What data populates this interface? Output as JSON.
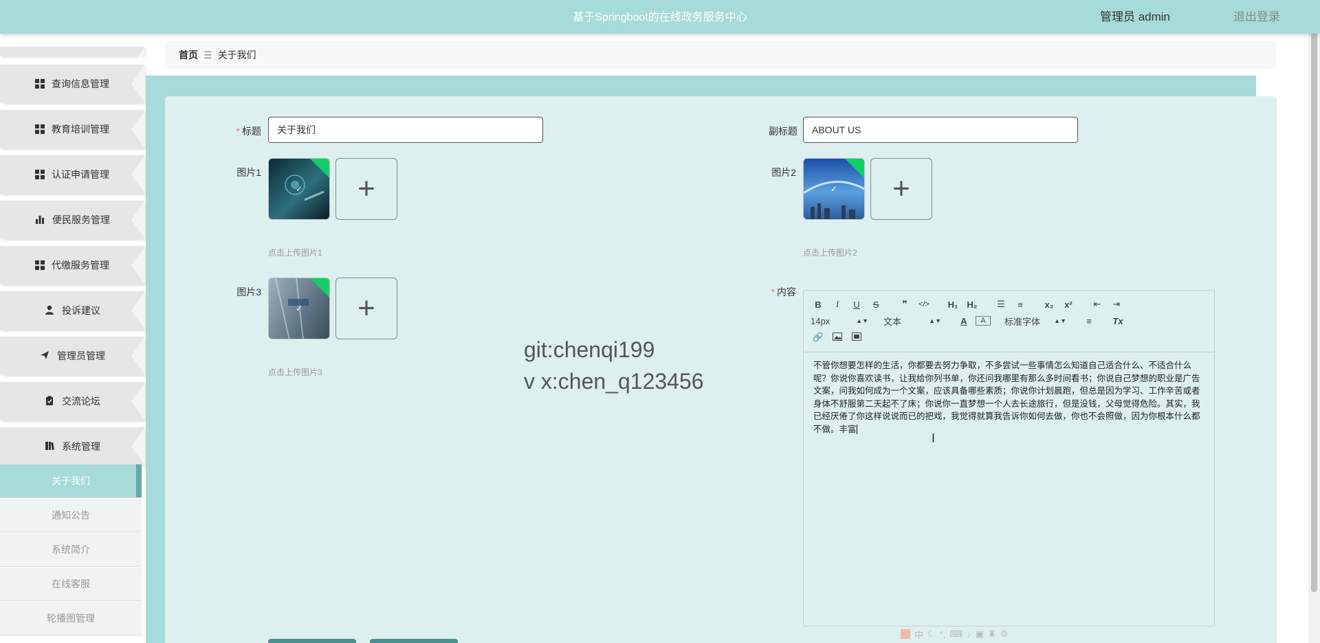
{
  "header": {
    "title": "基于Springboot的在线政务服务中心",
    "user": "管理员 admin",
    "logout": "退出登录"
  },
  "sidebar": {
    "items": [
      {
        "label": "查询信息管理",
        "icon": "grid-icon"
      },
      {
        "label": "教育培训管理",
        "icon": "grid-icon"
      },
      {
        "label": "认证申请管理",
        "icon": "grid-icon"
      },
      {
        "label": "便民服务管理",
        "icon": "bar-chart-icon"
      },
      {
        "label": "代缴服务管理",
        "icon": "grid-icon"
      },
      {
        "label": "投诉建议",
        "icon": "user-icon"
      },
      {
        "label": "管理员管理",
        "icon": "send-icon"
      },
      {
        "label": "交流论坛",
        "icon": "clipboard-icon"
      },
      {
        "label": "系统管理",
        "icon": "book-icon"
      }
    ],
    "subitems": [
      {
        "label": "关于我们",
        "active": true
      },
      {
        "label": "通知公告",
        "active": false
      },
      {
        "label": "系统简介",
        "active": false
      },
      {
        "label": "在线客服",
        "active": false
      },
      {
        "label": "轮播图管理",
        "active": false
      }
    ]
  },
  "breadcrumb": {
    "home": "首页",
    "separator": "☰",
    "current": "关于我们"
  },
  "form": {
    "title_label": "标题",
    "title_value": "关于我们",
    "subtitle_label": "副标题",
    "subtitle_value": "ABOUT US",
    "pic1_label": "图片1",
    "pic1_hint": "点击上传图片1",
    "pic2_label": "图片2",
    "pic2_hint": "点击上传图片2",
    "pic3_label": "图片3",
    "pic3_hint": "点击上传图片3",
    "content_label": "内容",
    "plus": "+"
  },
  "watermark": {
    "line1": "git:chenqi199",
    "line2": "v x:chen_q123456"
  },
  "editor": {
    "font_size": "14px",
    "block_type": "文本",
    "font_family": "标准字体",
    "h1": "H₁",
    "h2": "H₂",
    "sub": "x₂",
    "sup": "x²",
    "content": "不管你想要怎样的生活，你都要去努力争取，不多尝试一些事情怎么知道自己适合什么、不适合什么呢？你说你喜欢读书，让我给你列书单，你还问我哪里有那么多时间看书；你说自己梦想的职业是广告文案，问我如何成为一个文案，应该具备哪些素质；你说你计划晨跑，但总是因为学习、工作辛苦或者身体不舒服第二天起不了床；你说你一直梦想一个人去长途旅行，但是没钱，父母觉得危险。其实，我已经厌倦了你这样说说而已的把戏，我觉得就算我告诉你如何去做，你也不会照做，因为你根本什么都不做。丰富"
  },
  "ime": {
    "text": "中"
  },
  "colors": {
    "teal": "#a6dbd9",
    "panel": "#ddf0ef",
    "required": "#f56c6c",
    "success": "#13ce66"
  }
}
